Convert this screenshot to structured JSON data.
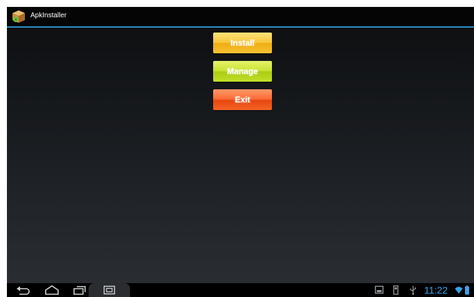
{
  "app": {
    "title": "ApkInstaller",
    "icon": "package-box-icon"
  },
  "buttons": {
    "install_label": "Install",
    "manage_label": "Manage",
    "exit_label": "Exit"
  },
  "colors": {
    "accent": "#2f8fc8",
    "install": "#f8c73c",
    "manage": "#c9e332",
    "exit": "#fb6a35",
    "clock": "#35a6e8"
  },
  "navbar": {
    "back_icon": "back-icon",
    "home_icon": "home-icon",
    "recents_icon": "recent-apps-icon",
    "screenshot_icon": "screenshot-icon"
  },
  "status": {
    "time": "11:22",
    "icons": [
      "gallery-icon",
      "sd-card-icon",
      "usb-icon",
      "wifi-icon",
      "battery-icon"
    ]
  }
}
